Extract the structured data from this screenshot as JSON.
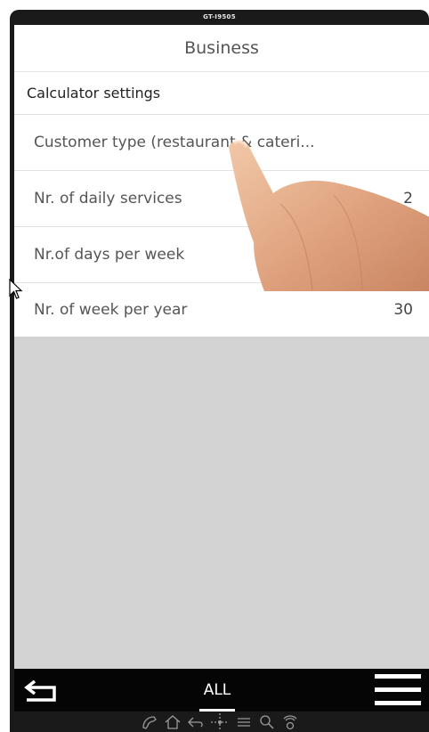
{
  "device": {
    "model": "GT-I9505"
  },
  "header": {
    "title": "Business"
  },
  "section": {
    "title": "Calculator settings"
  },
  "rows": [
    {
      "label": "Customer type (restaurant & cateri...",
      "value": ""
    },
    {
      "label": "Nr. of daily services",
      "value": "2"
    },
    {
      "label": "Nr.of days per week",
      "value": ""
    },
    {
      "label": "Nr. of week per year",
      "value": "30"
    }
  ],
  "bottom_nav": {
    "back_icon": "back-arrow-icon",
    "tab_label": "ALL",
    "menu_icon": "hamburger-menu-icon"
  },
  "softkeys": [
    "phone-icon",
    "home-icon",
    "back-icon",
    "dpad-icon",
    "menu-icon",
    "search-icon",
    "power-icon"
  ],
  "colors": {
    "background": "#d3d3d3",
    "nav_bar": "#050505",
    "text": "#555555"
  }
}
